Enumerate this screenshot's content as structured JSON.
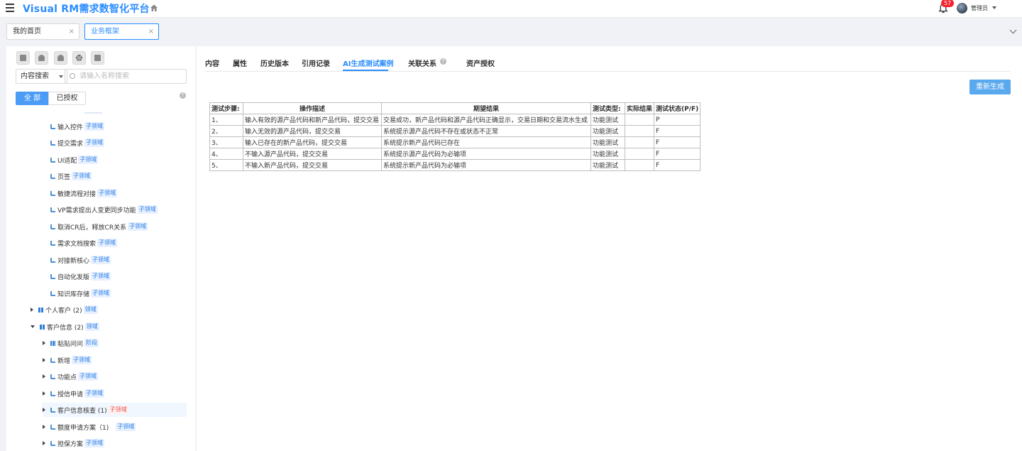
{
  "app": {
    "title": "Visual RM需求数智化平台",
    "notification_count": "57",
    "user_name": "管理员"
  },
  "page_tabs": [
    {
      "label": "我的首页",
      "close": "×"
    },
    {
      "label": "业务框架",
      "close": "×"
    }
  ],
  "left": {
    "search_scope": "内容搜索",
    "search_placeholder": "请输入名称搜索",
    "filter_all": "全 部",
    "filter_authorized": "已授权",
    "tree": [
      {
        "label": "输入控件",
        "tag": "子领域"
      },
      {
        "label": "提交需求",
        "tag": "子领域"
      },
      {
        "label": "UI适配",
        "tag": "子领域"
      },
      {
        "label": "页签",
        "tag": "子领域"
      },
      {
        "label": "敏捷流程对接",
        "tag": "子领域"
      },
      {
        "label": "VP需求提出人变更同步功能",
        "tag": "子领域"
      },
      {
        "label": "取消CR后，释放CR关系",
        "tag": "子领域"
      },
      {
        "label": "需求文档搜索",
        "tag": "子领域"
      },
      {
        "label": "对接新核心",
        "tag": "子领域"
      },
      {
        "label": "自动化发版",
        "tag": "子领域"
      },
      {
        "label": "知识库存储",
        "tag": "子领域"
      },
      {
        "label": "个人客户 (2)",
        "tag": "领域"
      },
      {
        "label": "客户信息 (2)",
        "tag": "领域"
      },
      {
        "label": "粘贴问问",
        "tag": "阶段"
      },
      {
        "label": "新增",
        "tag": "子领域"
      },
      {
        "label": "功能点",
        "tag": "子领域"
      },
      {
        "label": "授信申请",
        "tag": "子领域"
      },
      {
        "label": "客户信息核查 (1)",
        "tag": "子领域"
      },
      {
        "label": "额度申请方案（1)",
        "tag": "子领域"
      },
      {
        "label": "担保方案",
        "tag": "子领域"
      }
    ]
  },
  "content_tabs": [
    "内容",
    "属性",
    "历史版本",
    "引用记录",
    "AI生成测试案例",
    "关联关系",
    "资产授权"
  ],
  "regen_button": "重新生成",
  "testcase_table": {
    "headers": [
      "测试步骤:",
      "操作描述",
      "期望结果",
      "测试类型:",
      "实际结果",
      "测试状态(P/F)"
    ],
    "rows": [
      [
        "1、",
        "输入有效的源产品代码和新产品代码，提交交易",
        "交易成功，新产品代码和源产品代码正确显示，交易日期和交易流水生成",
        "功能测试",
        "",
        "P"
      ],
      [
        "2、",
        "输入无效的源产品代码，提交交易",
        "系统提示源产品代码不存在或状态不正常",
        "功能测试",
        "",
        "F"
      ],
      [
        "3、",
        "输入已存在的新产品代码，提交交易",
        "系统提示新产品代码已存在",
        "功能测试",
        "",
        "F"
      ],
      [
        "4、",
        "不输入源产品代码，提交交易",
        "系统提示源产品代码为必输项",
        "功能测试",
        "",
        "F"
      ],
      [
        "5、",
        "不输入新产品代码，提交交易",
        "系统提示新产品代码为必输项",
        "功能测试",
        "",
        "F"
      ]
    ]
  }
}
